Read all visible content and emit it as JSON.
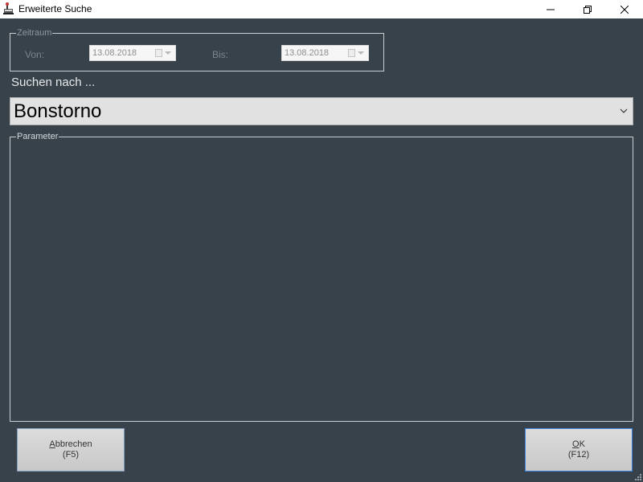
{
  "window": {
    "title": "Erweiterte Suche",
    "controls": {
      "minimize": "minimize",
      "maximize": "maximize",
      "close": "close"
    }
  },
  "zeitraum": {
    "title": "Zeitraum",
    "von": {
      "label": "Von:",
      "value": "13.08.2018"
    },
    "bis": {
      "label": "Bis:",
      "value": "13.08.2018"
    }
  },
  "search": {
    "label": "Suchen nach ...",
    "selected": "Bonstorno"
  },
  "parameter": {
    "title": "Parameter"
  },
  "buttons": {
    "cancel": {
      "accel": "A",
      "rest": "bbrechen",
      "shortcut": "(F5)"
    },
    "ok": {
      "accel": "O",
      "rest": "K",
      "shortcut": "(F12)"
    }
  },
  "colors": {
    "background": "#37424a",
    "titlebar": "#ffffff",
    "ok_border": "#3c7fd9"
  }
}
